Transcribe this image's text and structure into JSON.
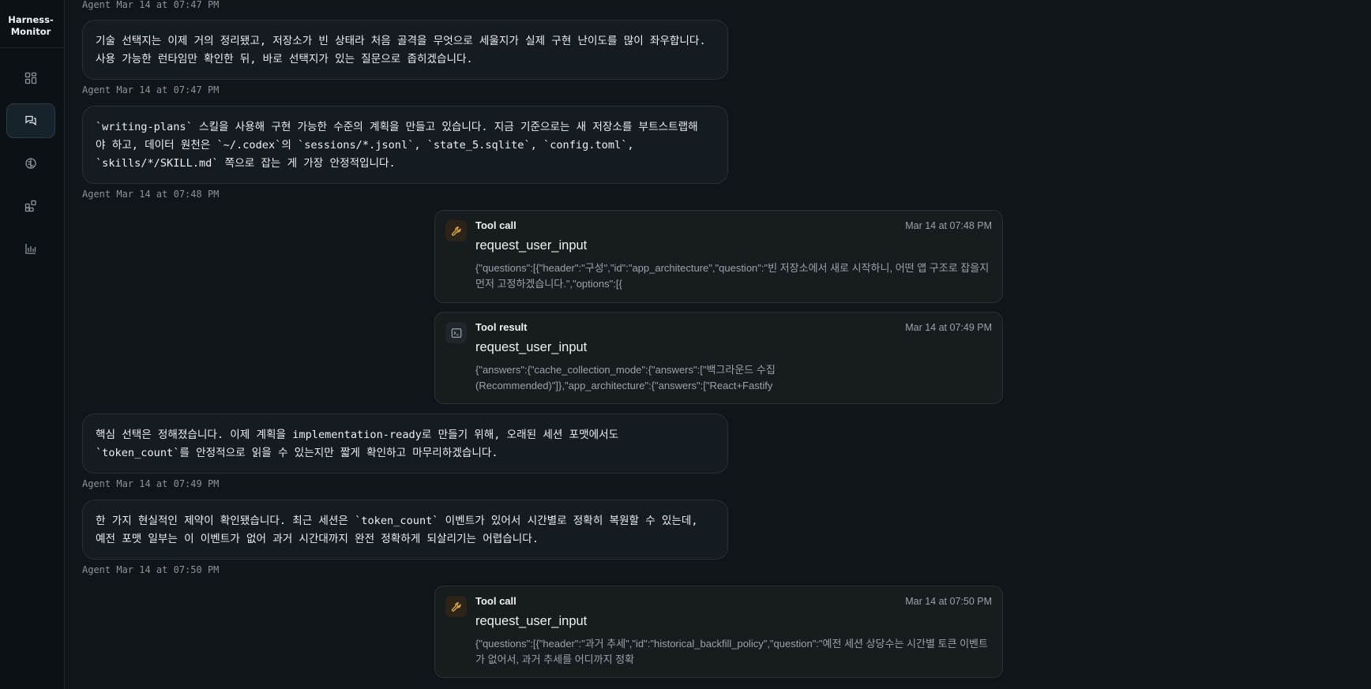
{
  "app": {
    "brand_line1": "Harness-",
    "brand_line2": "Monitor"
  },
  "sidebar": {
    "items": [
      {
        "name": "dashboard",
        "active": false
      },
      {
        "name": "sessions",
        "active": true
      },
      {
        "name": "brain",
        "active": false
      },
      {
        "name": "skills",
        "active": false
      },
      {
        "name": "analytics",
        "active": false
      }
    ]
  },
  "timeline": {
    "meta": [
      "Agent Mar 14 at 07:47 PM",
      "Agent Mar 14 at 07:47 PM",
      "Agent Mar 14 at 07:48 PM",
      "Agent Mar 14 at 07:49 PM",
      "Agent Mar 14 at 07:50 PM"
    ],
    "messages": [
      "기술 선택지는 이제 거의 정리됐고, 저장소가 빈 상태라 처음 골격을 무엇으로 세울지가 실제 구현 난이도를 많이 좌우합니다.\n사용 가능한 런타임만 확인한 뒤, 바로 선택지가 있는 질문으로 좁히겠습니다.",
      "`writing-plans` 스킬을 사용해 구현 가능한 수준의 계획을 만들고 있습니다. 지금 기준으로는 새 저장소를 부트스트랩해\n야 하고, 데이터 원천은 `~/.codex`의 `sessions/*.jsonl`, `state_5.sqlite`, `config.toml`,\n`skills/*/SKILL.md` 쪽으로 잡는 게 가장 안정적입니다.",
      "핵심 선택은 정해졌습니다. 이제 계획을 implementation-ready로 만들기 위해, 오래된 세션 포맷에서도\n`token_count`를 안정적으로 읽을 수 있는지만 짧게 확인하고 마무리하겠습니다.",
      "한 가지 현실적인 제약이 확인됐습니다. 최근 세션은 `token_count` 이벤트가 있어서 시간별로 정확히 복원할 수 있는데,\n예전 포맷 일부는 이 이벤트가 없어 과거 시간대까지 완전 정확하게 되살리기는 어렵습니다."
    ],
    "tools": [
      {
        "kind": "Tool call",
        "time": "Mar 14 at 07:48 PM",
        "name": "request_user_input",
        "body": "{\"questions\":[{\"header\":\"구성\",\"id\":\"app_architecture\",\"question\":\"빈 저장소에서 새로 시작하니, 어떤 앱 구조로 잡을지 먼저 고정하겠습니다.\",\"options\":[{"
      },
      {
        "kind": "Tool result",
        "time": "Mar 14 at 07:49 PM",
        "name": "request_user_input",
        "body": "{\"answers\":{\"cache_collection_mode\":{\"answers\":[\"백그라운드 수집\n(Recommended)\"]},\"app_architecture\":{\"answers\":[\"React+Fastify"
      },
      {
        "kind": "Tool call",
        "time": "Mar 14 at 07:50 PM",
        "name": "request_user_input",
        "body": "{\"questions\":[{\"header\":\"과거 추세\",\"id\":\"historical_backfill_policy\",\"question\":\"예전 세션 상당수는 시간별 토큰 이벤트가 없어서, 과거 추세를 어디까지 정확"
      }
    ]
  }
}
